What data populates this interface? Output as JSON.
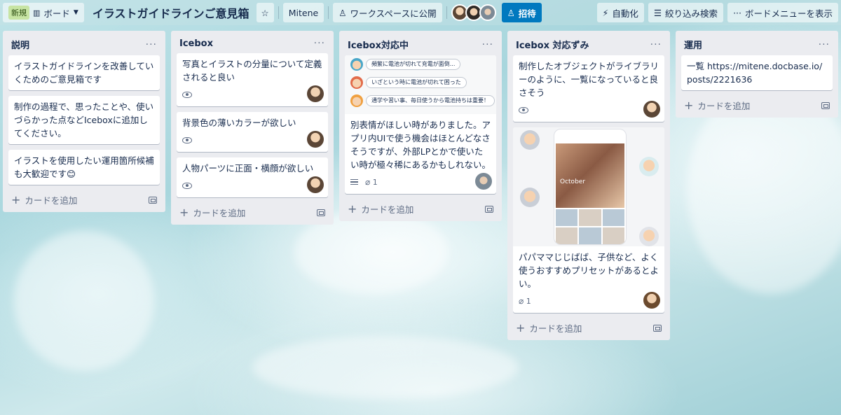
{
  "header": {
    "new_badge": "新規",
    "board_switch": "ボード",
    "board_title": "イラストガイドラインご意見箱",
    "workspace": "Mitene",
    "visibility": "ワークスペースに公開",
    "invite": "招待",
    "automation": "自動化",
    "filter": "絞り込み検索",
    "menu": "ボードメニューを表示"
  },
  "common": {
    "add_card": "カードを追加",
    "dots": "···"
  },
  "lists": [
    {
      "title": "説明",
      "cards": [
        {
          "text": "イラストガイドラインを改善していくためのご意見箱です"
        },
        {
          "text": "制作の過程で、思ったことや、使いづらかった点などIceboxに追加してください。"
        },
        {
          "text": "イラストを使用したい運用箇所候補も大歓迎です😊"
        }
      ]
    },
    {
      "title": "Icebox",
      "cards": [
        {
          "text": "写真とイラストの分量について定義されると良い"
        },
        {
          "text": "背景色の薄いカラーが欲しい"
        },
        {
          "text": "人物パーツに正面・横顔が欲しい"
        }
      ]
    },
    {
      "title": "Icebox対応中",
      "cards": [
        {
          "bubbles": [
            "頻繁に電池が切れて充電が面倒...",
            "いざという時に電池が切れて困った",
            "通学や習い事、毎日使うから電池持ちは重要！"
          ],
          "text": "別表情がほしい時がありました。アプリ内UIで使う機会はほとんどなさそうですが、外部LPとかで使いたい時が極々稀にあるかもしれない。",
          "attachments": "1"
        }
      ]
    },
    {
      "title": "Icebox 対応ずみ",
      "cards": [
        {
          "text": "制作したオブジェクトがライブラリーのように、一覧になっていると良さそう"
        },
        {
          "text": "パパママじじばば、子供など、よく使うおすすめプリセットがあるとよい。",
          "cover_month": "October",
          "attachments": "1"
        }
      ]
    },
    {
      "title": "運用",
      "cards": [
        {
          "text": "一覧 https://mitene.docbase.io/posts/2221636"
        }
      ]
    }
  ],
  "colors": {
    "accent": "#0079bf",
    "list_bg": "#ebecf0",
    "text": "#172b4d",
    "new_badge": "#c7e4a3"
  }
}
